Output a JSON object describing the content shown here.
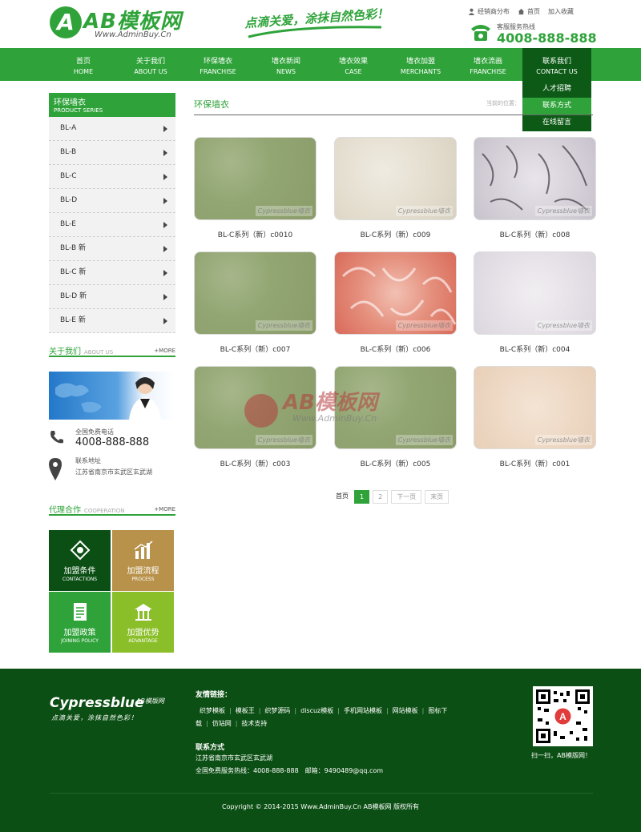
{
  "header": {
    "logo_text": "AB模板网",
    "logo_url": "Www.AdminBuy.Cn",
    "slogan": "点滴关爱，涂抹自然色彩！",
    "top_links": [
      "经销商分布",
      "首页",
      "加入收藏"
    ],
    "hotline_label": "客服服务热线",
    "hotline_number": "4008-888-888"
  },
  "nav": [
    {
      "zh": "首页",
      "en": "HOME"
    },
    {
      "zh": "关于我们",
      "en": "ABOUT US"
    },
    {
      "zh": "环保墙衣",
      "en": "FRANCHISE"
    },
    {
      "zh": "墙衣新闻",
      "en": "NEWS"
    },
    {
      "zh": "墙衣效果",
      "en": "CASE"
    },
    {
      "zh": "墙衣加盟",
      "en": "MERCHANTS"
    },
    {
      "zh": "墙衣流画",
      "en": "FRANCHISE"
    },
    {
      "zh": "联系我们",
      "en": "CONTACT US"
    }
  ],
  "dropdown": [
    "人才招聘",
    "联系方式",
    "在线留言"
  ],
  "sidebar": {
    "category_title": "环保墙衣",
    "category_title_en": "PRODUCT SERIES",
    "categories": [
      "BL-A",
      "BL-B",
      "BL-C",
      "BL-D",
      "BL-E",
      "BL-B 新",
      "BL-C 新",
      "BL-D 新",
      "BL-E 新"
    ],
    "about_title": "关于我们",
    "about_title_en": "ABOUT US",
    "more": "+MORE",
    "phone_label": "全国免费电话",
    "phone_number": "4008-888-888",
    "addr_label": "联系地址",
    "addr_value": "江苏省南京市玄武区玄武湖",
    "coop_title": "代理合作",
    "coop_title_en": "COOPERATION",
    "coop": [
      {
        "zh": "加盟条件",
        "en": "CONTACTIONS",
        "color": "#0c4f14"
      },
      {
        "zh": "加盟流程",
        "en": "PROCESS",
        "color": "#b8924a"
      },
      {
        "zh": "加盟政策",
        "en": "JOINING POLICY",
        "color": "#2fa33a"
      },
      {
        "zh": "加盟优势",
        "en": "ADVANTAGE",
        "color": "#8bbf2a"
      }
    ]
  },
  "main": {
    "title": "环保墙衣",
    "location": "当前的位置：",
    "watermark": "Cypressblue墙衣",
    "center_watermark_name": "AB模板网",
    "center_watermark_url": "Www.AdminBuy.Cn",
    "products": [
      {
        "caption": "BL-C系列（新）c0010",
        "texture": "green"
      },
      {
        "caption": "BL-C系列（新）c009",
        "texture": "cream"
      },
      {
        "caption": "BL-C系列（新）c008",
        "texture": "gray"
      },
      {
        "caption": "BL-C系列（新）c007",
        "texture": "green"
      },
      {
        "caption": "BL-C系列（新）c006",
        "texture": "red"
      },
      {
        "caption": "BL-C系列（新）c004",
        "texture": "lilac"
      },
      {
        "caption": "BL-C系列（新）c003",
        "texture": "green"
      },
      {
        "caption": "BL-C系列（新）c005",
        "texture": "green"
      },
      {
        "caption": "BL-C系列（新）c001",
        "texture": "peach"
      }
    ],
    "pager": {
      "first": "首页",
      "pages": [
        "1",
        "2"
      ],
      "next": "下一页",
      "last": "末页",
      "current": "1"
    }
  },
  "footer": {
    "brand": "Cypressblue",
    "brand_sub": "AB模版网",
    "brand_slogan": "点滴关爱，涂抹自然色彩！",
    "links_title": "友情链接：",
    "links": [
      "织梦模板",
      "模板王",
      "织梦源码",
      "discuz模板",
      "手机网站模板",
      "网站模板",
      "图标下载",
      "仿站网",
      "技术支持"
    ],
    "contact_title": "联系方式",
    "address": "江苏省南京市玄武区玄武湖",
    "phone_line": "全国免费服务热线：4008-888-888　邮箱：9490489@qq.com",
    "qr_caption": "扫一扫，AB模版网！",
    "copyright": "Copyright © 2014-2015 Www.AdminBuy.Cn AB模板网 版权所有"
  },
  "colors": {
    "brand_green": "#2fa33a",
    "dark_green": "#0c4f14"
  }
}
